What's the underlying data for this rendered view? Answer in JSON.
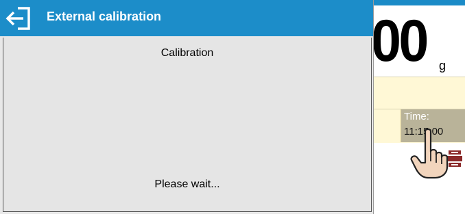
{
  "dialog": {
    "title": "External calibration",
    "subtitle": "Calibration",
    "status": "Please wait..."
  },
  "background": {
    "reading": "00",
    "unit": "g",
    "time_label": "Time:",
    "time_value": "11:15:00"
  },
  "icons": {
    "exit": "exit-arrow-icon",
    "cursor": "hand-pointer-icon",
    "printer": "printer-icon"
  },
  "colors": {
    "header": "#1c8dc9",
    "dialog_bg": "#e8e8e8",
    "info_bg": "#fff8d6",
    "time_cell": "#b9b399"
  }
}
